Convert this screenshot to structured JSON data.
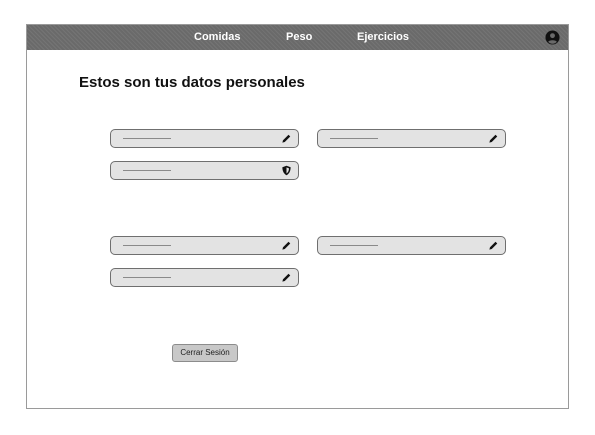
{
  "nav": {
    "items": [
      {
        "label": "Comidas"
      },
      {
        "label": "Peso"
      },
      {
        "label": "Ejercicios"
      }
    ],
    "avatar_icon": "user-circle-icon"
  },
  "page": {
    "title": "Estos son tus datos personales"
  },
  "fields": [
    {
      "icon": "pencil-icon"
    },
    {
      "icon": "pencil-icon"
    },
    {
      "icon": "shield-icon"
    },
    {
      "icon": "pencil-icon"
    },
    {
      "icon": "pencil-icon"
    },
    {
      "icon": "pencil-icon"
    }
  ],
  "actions": {
    "logout_label": "Cerrar Sesión"
  },
  "colors": {
    "navbar": "#6a6a6a",
    "field_bg": "#e3e3e3",
    "button_bg": "#c8c8c8"
  }
}
